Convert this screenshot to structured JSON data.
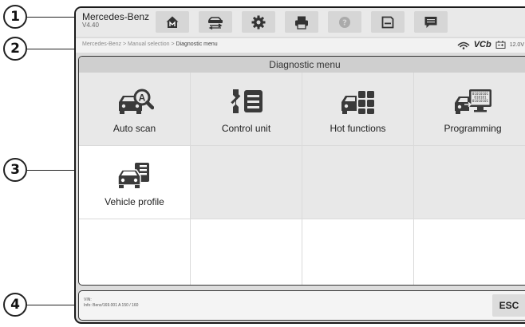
{
  "callouts": [
    "1",
    "2",
    "3",
    "4"
  ],
  "toolbar": {
    "brand": "Mercedes-Benz",
    "version": "V4.40",
    "buttons": [
      {
        "name": "home",
        "icon": "home-icon"
      },
      {
        "name": "vehicle-swap",
        "icon": "car-swap-icon"
      },
      {
        "name": "settings",
        "icon": "gear-icon"
      },
      {
        "name": "print",
        "icon": "printer-icon"
      },
      {
        "name": "help",
        "icon": "help-icon"
      },
      {
        "name": "save",
        "icon": "save-icon"
      },
      {
        "name": "data-logging",
        "icon": "message-icon"
      }
    ]
  },
  "breadcrumb": {
    "path": "Mercedes-Benz > Manual selection > ",
    "current": "Diagnostic menu"
  },
  "status": {
    "vci_label": "VCb",
    "voltage": "12.0V",
    "icons": [
      "wifi-icon",
      "battery-icon"
    ]
  },
  "main": {
    "title": "Diagnostic menu",
    "tiles": [
      {
        "label": "Auto scan",
        "icon": "auto-scan-icon"
      },
      {
        "label": "Control unit",
        "icon": "control-unit-icon"
      },
      {
        "label": "Hot functions",
        "icon": "hot-functions-icon"
      },
      {
        "label": "Programming",
        "icon": "programming-icon"
      },
      {
        "label": "Vehicle profile",
        "icon": "vehicle-profile-icon"
      }
    ]
  },
  "footer": {
    "vin": "VIN:",
    "info": "Info: Benz/169.001 A 150 / 160",
    "esc_label": "ESC"
  },
  "colors": {
    "frame": "#1a1a1a",
    "toolbar_bg": "#e9e9e9",
    "button_bg": "#d6d6d6",
    "title_bar": "#cfcfcf",
    "tile_grey": "#e8e8e8",
    "icon": "#3a3a3a"
  }
}
